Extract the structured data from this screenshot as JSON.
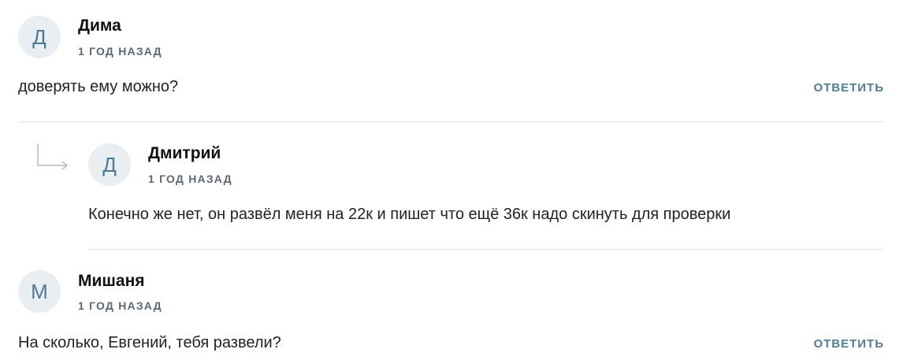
{
  "comments": [
    {
      "avatar_letter": "Д",
      "author": "Дима",
      "time": "1 ГОД НАЗАД",
      "text": "доверять ему можно?",
      "reply_label": "ОТВЕТИТЬ"
    },
    {
      "avatar_letter": "Д",
      "author": "Дмитрий",
      "time": "1 ГОД НАЗАД",
      "text": "Конечно же нет, он развёл меня на 22к и пишет что ещё 36к надо скинуть для проверки"
    },
    {
      "avatar_letter": "М",
      "author": "Мишаня",
      "time": "1 ГОД НАЗАД",
      "text": "На сколько, Евгений, тебя развели?",
      "reply_label": "ОТВЕТИТЬ"
    }
  ],
  "icons": {
    "reply_indicator": "reply-arrow-icon"
  },
  "colors": {
    "accent": "#4e7d97",
    "avatar_bg": "#e9eef2",
    "avatar_text": "#4d7a93"
  }
}
